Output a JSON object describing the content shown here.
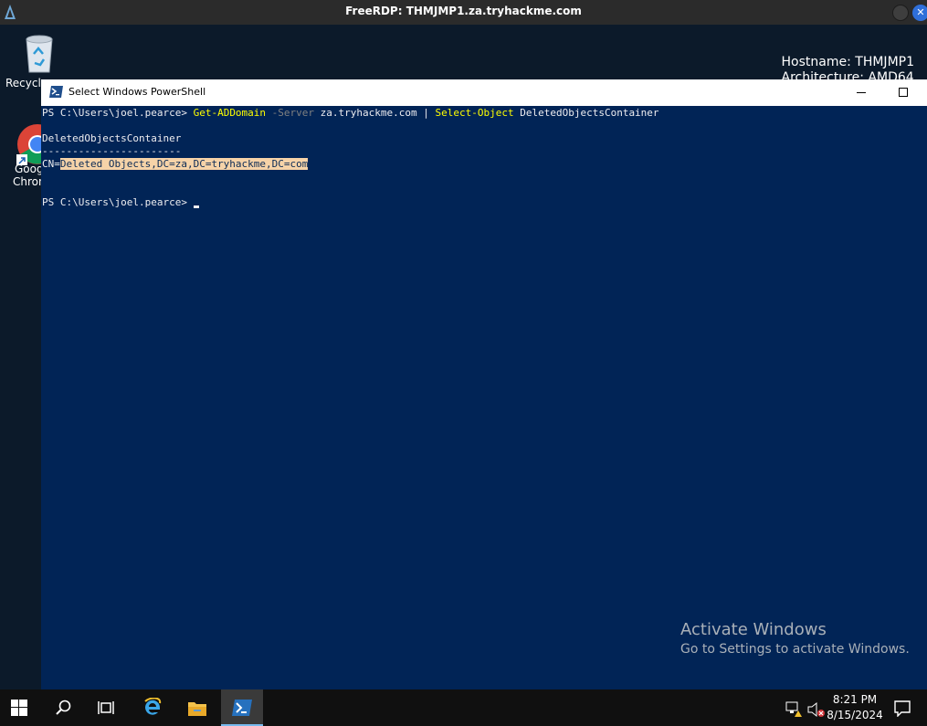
{
  "rdp": {
    "title": "FreeRDP: THMJMP1.za.tryhackme.com"
  },
  "desktop": {
    "icons": [
      {
        "label": "Recycle"
      },
      {
        "label_line1": "Goog",
        "label_line2": "Chron"
      }
    ],
    "bginfo": {
      "hostname": "Hostname: THMJMP1",
      "architecture": "Architecture: AMD64"
    }
  },
  "powershell": {
    "title": "Select Windows PowerShell",
    "lines": {
      "prompt1": "PS C:\\Users\\joel.pearce> ",
      "cmd1": "Get-ADDomain",
      "param1": " -Server",
      "arg1": " za.tryhackme.com ",
      "pipe": "| ",
      "cmd2": "Select-Object",
      "arg2": " DeletedObjectsContainer",
      "header": "DeletedObjectsContainer",
      "separator": "-----------------------",
      "value_prefix": "CN=",
      "value_selected": "Deleted Objects,DC=za,DC=tryhackme,DC=com",
      "prompt2": "PS C:\\Users\\joel.pearce> "
    }
  },
  "watermark": {
    "title": "Activate Windows",
    "subtitle": "Go to Settings to activate Windows."
  },
  "taskbar": {
    "time": "8:21 PM",
    "date": "8/15/2024",
    "buttons": [
      "start-icon",
      "search-icon",
      "task-view-icon",
      "internet-explorer-icon",
      "file-explorer-icon",
      "powershell-icon"
    ],
    "active": "powershell-icon"
  },
  "colors": {
    "console_bg": "#012456",
    "command": "#ffff00",
    "parameter": "#808080",
    "selection": "#f6d3a8"
  }
}
